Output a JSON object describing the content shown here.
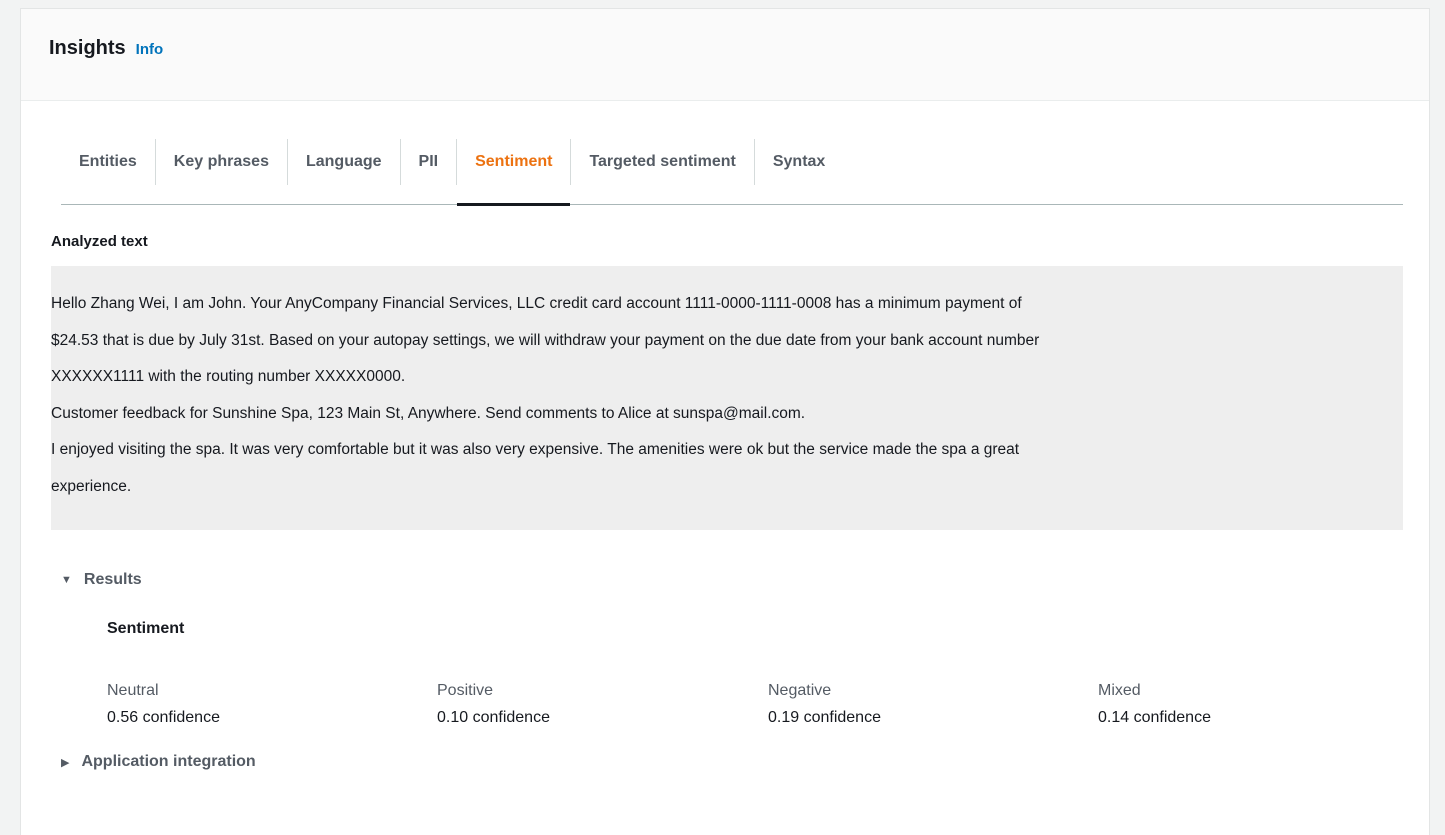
{
  "panel": {
    "title": "Insights",
    "info_link": "Info"
  },
  "tabs": [
    {
      "label": "Entities",
      "active": false
    },
    {
      "label": "Key phrases",
      "active": false
    },
    {
      "label": "Language",
      "active": false
    },
    {
      "label": "PII",
      "active": false
    },
    {
      "label": "Sentiment",
      "active": true
    },
    {
      "label": "Targeted sentiment",
      "active": false
    },
    {
      "label": "Syntax",
      "active": false
    }
  ],
  "analyzed": {
    "label": "Analyzed text",
    "lines": [
      "Hello Zhang Wei, I am John. Your AnyCompany Financial Services, LLC credit card account 1111-0000-1111-0008 has a minimum payment of",
      "$24.53 that is due by July 31st. Based on your autopay settings, we will withdraw your payment on the due date from your bank account number",
      "XXXXXX1111 with the routing number XXXXX0000.",
      "Customer feedback for Sunshine Spa, 123 Main St, Anywhere. Send comments to Alice at sunspa@mail.com.",
      "I enjoyed visiting the spa. It was very comfortable but it was also very expensive. The amenities were ok but the service made the spa a great",
      "experience."
    ]
  },
  "results": {
    "toggle_label": "Results",
    "expanded": true,
    "heading": "Sentiment",
    "items": [
      {
        "label": "Neutral",
        "value": "0.56 confidence"
      },
      {
        "label": "Positive",
        "value": "0.10 confidence"
      },
      {
        "label": "Negative",
        "value": "0.19 confidence"
      },
      {
        "label": "Mixed",
        "value": "0.14 confidence"
      }
    ]
  },
  "app_integration": {
    "toggle_label": "Application integration",
    "expanded": false
  },
  "icons": {
    "expanded_caret": "caret-down-icon",
    "collapsed_caret": "caret-right-icon"
  },
  "colors": {
    "active_tab": "#ec7211",
    "link": "#0073bb",
    "text_box_bg": "#eeeeee"
  }
}
